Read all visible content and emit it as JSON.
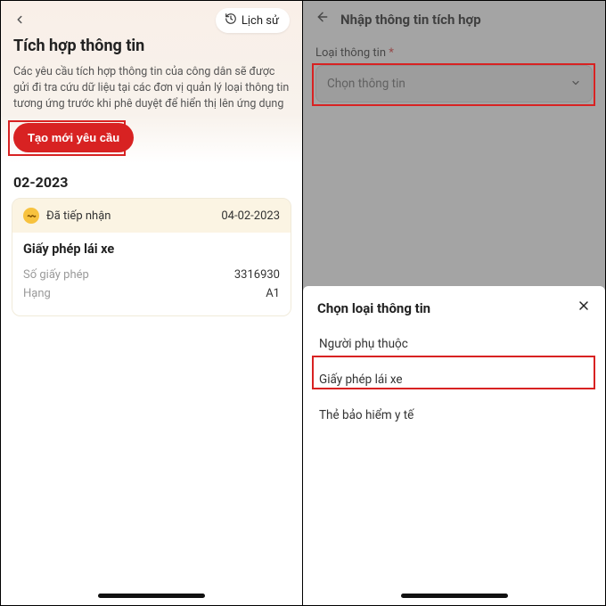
{
  "left": {
    "history_label": "Lịch sử",
    "title": "Tích hợp thông tin",
    "description": "Các yêu cầu tích hợp thông tin của công dân sẽ được gửi đi tra cứu dữ liệu tại các đơn vị quản lý loại thông tin tương ứng trước khi phê duyệt để hiển thị lên ứng dụng",
    "create_label": "Tạo mới yêu cầu",
    "month": "02-2023",
    "card": {
      "status": "Đã tiếp nhận",
      "date": "04-02-2023",
      "title": "Giấy phép lái xe",
      "rows": [
        {
          "k": "Số giấy phép",
          "v": "3316930"
        },
        {
          "k": "Hạng",
          "v": "A1"
        }
      ]
    }
  },
  "right": {
    "header_title": "Nhập thông tin tích hợp",
    "field_label": "Loại thông tin",
    "field_required": "*",
    "select_placeholder": "Chọn thông tin",
    "sheet_title": "Chọn loại thông tin",
    "options": [
      "Người phụ thuộc",
      "Giấy phép lái xe",
      "Thẻ bảo hiểm y tế"
    ]
  }
}
